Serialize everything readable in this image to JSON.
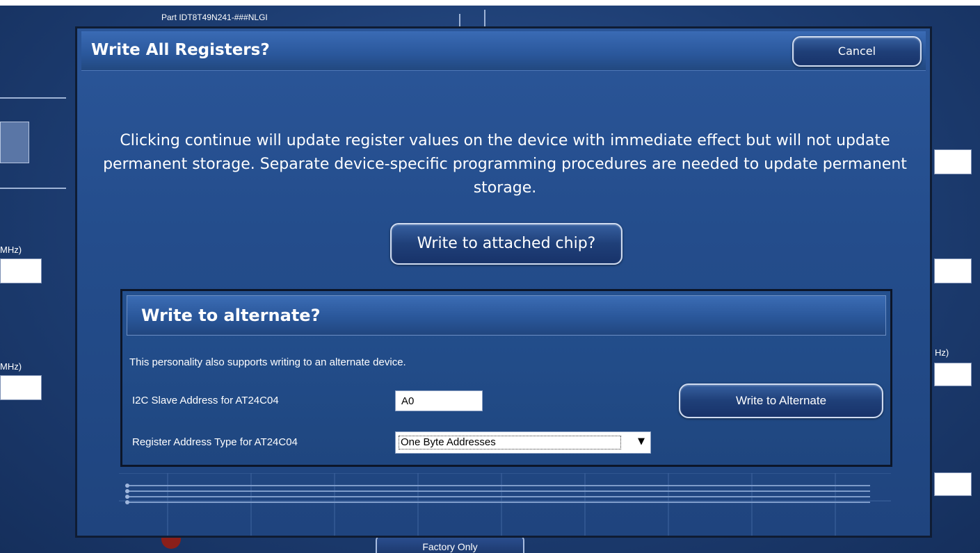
{
  "background": {
    "part_label": "Part IDT8T49N241-###NLGI",
    "mhz_left_1": "MHz)",
    "mhz_left_2": "MHz)",
    "hz_right": "Hz)",
    "factory_button": "Factory Only"
  },
  "dialog": {
    "title": "Write All Registers?",
    "cancel_label": "Cancel",
    "message": "Clicking continue will update register values on the device with immediate effect but will not update permanent storage. Separate device-specific programming procedures are needed to update permanent storage.",
    "attached_chip_button": "Write to attached chip?"
  },
  "alternate": {
    "title": "Write to alternate?",
    "description": "This personality also supports writing to an alternate device.",
    "slave_address_label": "I2C Slave Address for AT24C04",
    "slave_address_value": "A0",
    "write_button": "Write to Alternate",
    "register_type_label": "Register Address Type for AT24C04",
    "register_type_value": "One Byte Addresses"
  },
  "colors": {
    "background": "#1d3d72",
    "dialog": "#244d8c",
    "button_border": "#d0dcf0"
  }
}
